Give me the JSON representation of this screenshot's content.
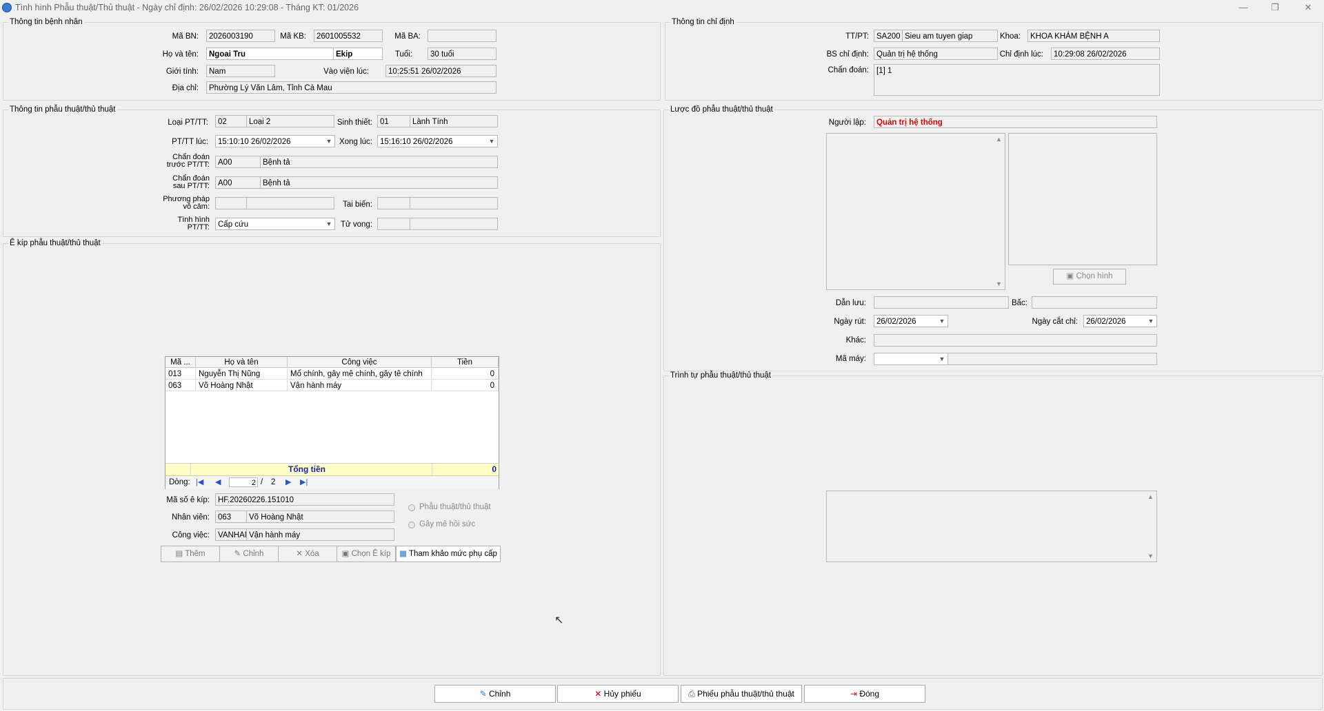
{
  "window": {
    "title": "Tình hình Phẫu thuật/Thủ thuật - Ngày chỉ định: 26/02/2026 10:29:08 - Tháng KT: 01/2026",
    "minimize": "—",
    "restore": "❐",
    "close": "✕"
  },
  "patient": {
    "group_title": "Thông tin bệnh nhân",
    "ma_bn_label": "Mã BN:",
    "ma_bn": "2026003190",
    "ma_kb_label": "Mã KB:",
    "ma_kb": "2601005532",
    "ma_ba_label": "Mã BA:",
    "ma_ba": "",
    "ho_ten_label": "Họ và tên:",
    "ho_ten": "Ngoai Tru",
    "ekip": "Ekip",
    "tuoi_label": "Tuổi:",
    "tuoi": "30 tuổi",
    "gioi_tinh_label": "Giới tính:",
    "gioi_tinh": "Nam",
    "vao_vien_label": "Vào viện lúc:",
    "vao_vien": "10:25:51 26/02/2026",
    "dia_chi_label": "Địa chỉ:",
    "dia_chi": "Phường Lý Văn Lâm, Tỉnh Cà Mau"
  },
  "order": {
    "group_title": "Thông tin chỉ định",
    "ttpt_label": "TT/PT:",
    "ttpt_code": "SA200",
    "ttpt_name": "Sieu am tuyen giap",
    "khoa_label": "Khoa:",
    "khoa": "KHOA KHÁM BỆNH A",
    "bs_label": "BS chỉ định:",
    "bs": "Quản trị hệ thống",
    "chi_dinh_luc_label": "Chỉ định lúc:",
    "chi_dinh_luc": "10:29:08 26/02/2026",
    "chan_doan_label": "Chẩn đoán:",
    "chan_doan": "[1] 1"
  },
  "surgery": {
    "group_title": "Thông tin phẫu thuật/thủ thuật",
    "loai_label": "Loại PT/TT:",
    "loai_code": "02",
    "loai_name": "Loại 2",
    "sinh_thiet_label": "Sinh thiết:",
    "sinh_thiet_code": "01",
    "sinh_thiet_name": "Lành Tính",
    "ptt_luc_label": "PT/TT lúc:",
    "ptt_luc": "15:10:10 26/02/2026",
    "xong_luc_label": "Xong lúc:",
    "xong_luc": "15:16:10 26/02/2026",
    "cd_truoc_label1": "Chẩn đoán",
    "cd_truoc_label2": "trước PT/TT:",
    "cd_truoc_code": "A00",
    "cd_truoc_name": "Bệnh tả",
    "cd_sau_label1": "Chẩn đoán",
    "cd_sau_label2": "sau PT/TT:",
    "cd_sau_code": "A00",
    "cd_sau_name": "Bệnh tả",
    "vo_cam_label1": "Phương pháp",
    "vo_cam_label2": "vô cảm:",
    "tai_bien_label": "Tai biến:",
    "tinh_hinh_label1": "Tình hình",
    "tinh_hinh_label2": "PT/TT:",
    "tinh_hinh": "Cấp cứu",
    "tu_vong_label": "Tử vong:"
  },
  "team": {
    "group_title": "Ê kíp phẫu thuật/thủ thuật",
    "columns": [
      "Mã ...",
      "Họ và tên",
      "Công việc",
      "Tiền"
    ],
    "rows": [
      {
        "ma": "013",
        "ten": "Nguyễn Thị Nũng",
        "cong_viec": "Mổ chính, gây mê chính, gây tê chính",
        "tien": "0"
      },
      {
        "ma": "063",
        "ten": "Võ Hoàng Nhật",
        "cong_viec": "Vận hành máy",
        "tien": "0"
      }
    ],
    "total_label": "Tổng tiền",
    "total": "0",
    "nav_label": "Dòng:",
    "nav_current": "2",
    "nav_sep": "/",
    "nav_total": "2",
    "ma_so_label": "Mã số ê kíp:",
    "ma_so": "HF.20260226.151010",
    "nhan_vien_label": "Nhân viên:",
    "nhan_vien_code": "063",
    "nhan_vien_name": "Võ Hoàng Nhật",
    "cong_viec_label": "Công việc:",
    "cong_viec_code": "VANHAN",
    "cong_viec_name": "Vận hành máy",
    "radio_pt": "Phẫu thuật/thủ thuật",
    "radio_gm": "Gây mê hồi sức",
    "btn_them": "Thêm",
    "btn_chinh": "Chỉnh",
    "btn_xoa": "Xóa",
    "btn_chon": "Chọn Ê kíp",
    "btn_tham_khao": "Tham khảo mức phụ cấp"
  },
  "diagram": {
    "group_title": "Lược đồ phẫu thuật/thủ thuật",
    "nguoi_lap_label": "Người lập:",
    "nguoi_lap": "Quản trị hệ thống",
    "chon_hinh": "Chọn hình",
    "dan_luu_label": "Dẫn lưu:",
    "bac_label": "Bấc:",
    "ngay_rut_label": "Ngày rút:",
    "ngay_rut": "26/02/2026",
    "ngay_cat_chi_label": "Ngày cắt chỉ:",
    "ngay_cat_chi": "26/02/2026",
    "khac_label": "Khác:",
    "ma_may_label": "Mã máy:"
  },
  "sequence": {
    "group_title": "Trình tự phẫu thuật/thủ thuật"
  },
  "footer": {
    "chinh": "Chỉnh",
    "huy_phieu": "Hủy phiếu",
    "phieu": "Phiếu phẫu thuật/thủ thuật",
    "dong": "Đóng"
  }
}
